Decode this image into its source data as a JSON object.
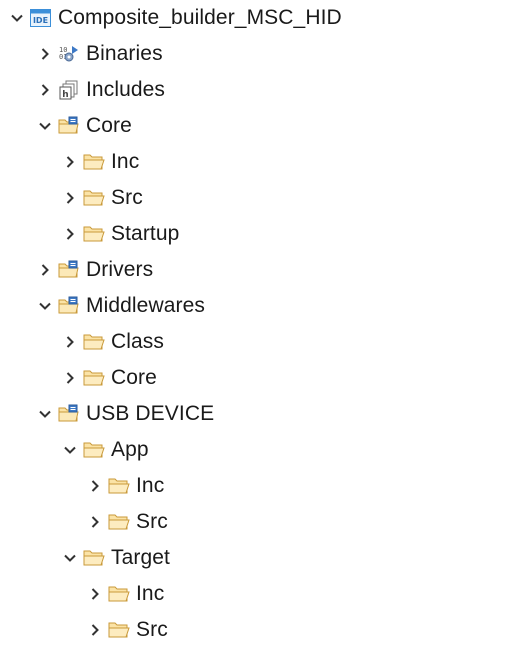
{
  "project_explorer": {
    "project": {
      "label": "Composite_builder_MSC_HID",
      "icon": "ide-project-icon",
      "expanded": true
    },
    "items": [
      {
        "label": "Binaries",
        "icon": "binaries-icon",
        "expanded": false,
        "depth": 1
      },
      {
        "label": "Includes",
        "icon": "includes-icon",
        "expanded": false,
        "depth": 1
      },
      {
        "label": "Core",
        "icon": "source-folder-icon",
        "expanded": true,
        "depth": 1
      },
      {
        "label": "Inc",
        "icon": "folder-icon",
        "expanded": false,
        "depth": 2
      },
      {
        "label": "Src",
        "icon": "folder-icon",
        "expanded": false,
        "depth": 2
      },
      {
        "label": "Startup",
        "icon": "folder-icon",
        "expanded": false,
        "depth": 2
      },
      {
        "label": "Drivers",
        "icon": "source-folder-icon",
        "expanded": false,
        "depth": 1
      },
      {
        "label": "Middlewares",
        "icon": "source-folder-icon",
        "expanded": true,
        "depth": 1
      },
      {
        "label": "Class",
        "icon": "folder-icon",
        "expanded": false,
        "depth": 2
      },
      {
        "label": "Core",
        "icon": "folder-icon",
        "expanded": false,
        "depth": 2
      },
      {
        "label": "USB DEVICE",
        "icon": "source-folder-icon",
        "expanded": true,
        "depth": 1
      },
      {
        "label": "App",
        "icon": "folder-icon",
        "expanded": true,
        "depth": 2
      },
      {
        "label": "Inc",
        "icon": "folder-icon",
        "expanded": false,
        "depth": 3
      },
      {
        "label": "Src",
        "icon": "folder-icon",
        "expanded": false,
        "depth": 3
      },
      {
        "label": "Target",
        "icon": "folder-icon",
        "expanded": true,
        "depth": 2
      },
      {
        "label": "Inc",
        "icon": "folder-icon",
        "expanded": false,
        "depth": 3
      },
      {
        "label": "Src",
        "icon": "folder-icon",
        "expanded": false,
        "depth": 3
      }
    ]
  },
  "colors": {
    "folder_fill": "#fbe3a6",
    "folder_stroke": "#c99a3a",
    "source_badge": "#3d79c6",
    "ide_blue": "#3b8fd9",
    "chevron": "#333333"
  }
}
